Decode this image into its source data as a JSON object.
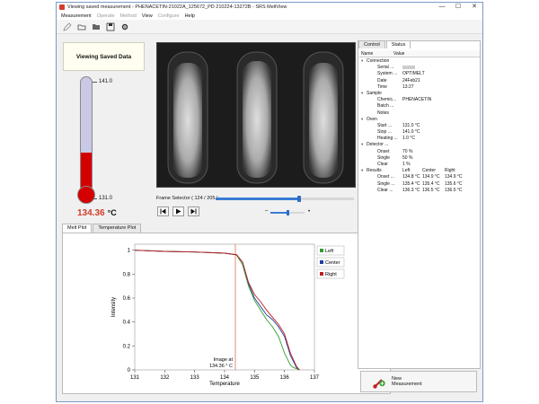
{
  "window": {
    "title": "Viewing saved measurement - PHENACETIN-21022A_125672_PD 210224-13272B - SRS MeltView",
    "controls": [
      "—",
      "☐",
      "✕"
    ]
  },
  "menu": [
    {
      "label": "Measurement",
      "enabled": true
    },
    {
      "label": "Operate",
      "enabled": false
    },
    {
      "label": "Method",
      "enabled": false
    },
    {
      "label": "View",
      "enabled": true
    },
    {
      "label": "Configure",
      "enabled": false
    },
    {
      "label": "Help",
      "enabled": true
    }
  ],
  "toolbar": {
    "icons": [
      "pencil-icon",
      "open-folder-icon",
      "folder-icon",
      "save-icon",
      "settings-icon"
    ]
  },
  "left_panel": {
    "viewing_label": "Viewing Saved Data",
    "thermo_top_label": "141.0",
    "thermo_bottom_label": "131.0",
    "thermo_fill_fraction": 0.34,
    "temperature_value": "134.36",
    "temperature_unit": "°C"
  },
  "frame_selector": {
    "label": "Frame Selector ( 124 / 205 )",
    "current": 124,
    "total": 205,
    "volume_fraction": 0.5
  },
  "plot": {
    "tabs": [
      "Melt Plot",
      "Temperature Plot"
    ],
    "active_tab": 0,
    "annotation_line1": "Image at",
    "annotation_line2": "134.36 ° C",
    "legend": [
      {
        "name": "Left",
        "color": "#2e9e2e"
      },
      {
        "name": "Center",
        "color": "#2040a0"
      },
      {
        "name": "Right",
        "color": "#c02020"
      }
    ]
  },
  "chart_data": {
    "type": "line",
    "title": "",
    "xlabel": "Temperature",
    "ylabel": "Intensity",
    "xlim": [
      131,
      137
    ],
    "ylim": [
      0,
      1.05
    ],
    "xticks": [
      "131",
      "132",
      "133",
      "134",
      "135",
      "136",
      "137"
    ],
    "yticks": [
      "0",
      "0.2",
      "0.4",
      "0.6",
      "0.8",
      "1"
    ],
    "marker_x": 134.36,
    "series": [
      {
        "name": "Left",
        "color": "#2e9e2e",
        "x": [
          131,
          132,
          133,
          134,
          134.4,
          134.6,
          134.8,
          135.0,
          135.2,
          135.4,
          135.6,
          135.8,
          136.0,
          136.2,
          136.3,
          136.5
        ],
        "y": [
          1.0,
          0.99,
          0.985,
          0.975,
          0.96,
          0.88,
          0.7,
          0.58,
          0.5,
          0.42,
          0.36,
          0.28,
          0.14,
          0.04,
          0.02,
          0.0
        ]
      },
      {
        "name": "Center",
        "color": "#2040a0",
        "x": [
          131,
          132,
          133,
          134,
          134.4,
          134.6,
          134.8,
          135.0,
          135.2,
          135.4,
          135.6,
          135.8,
          136.0,
          136.2,
          136.4,
          136.5
        ],
        "y": [
          1.0,
          0.99,
          0.985,
          0.975,
          0.962,
          0.9,
          0.72,
          0.6,
          0.53,
          0.46,
          0.42,
          0.36,
          0.28,
          0.12,
          0.02,
          0.0
        ]
      },
      {
        "name": "Right",
        "color": "#c02020",
        "x": [
          131,
          132,
          133,
          134,
          134.4,
          134.6,
          134.8,
          135.0,
          135.2,
          135.4,
          135.6,
          135.8,
          136.0,
          136.2,
          136.4,
          136.5
        ],
        "y": [
          1.0,
          0.99,
          0.985,
          0.975,
          0.962,
          0.9,
          0.73,
          0.63,
          0.57,
          0.5,
          0.44,
          0.38,
          0.3,
          0.14,
          0.03,
          0.0
        ]
      }
    ]
  },
  "status_panel": {
    "tabs": [
      "Control",
      "Status"
    ],
    "active_tab": 1,
    "header_name": "Name",
    "header_value": "Value",
    "sections": [
      {
        "title": "Connection",
        "rows": [
          {
            "name": "Serial ...",
            "value": "",
            "redacted": true
          },
          {
            "name": "System ...",
            "value": "OPTIMELT"
          },
          {
            "name": "Date",
            "value": "24Feb21"
          },
          {
            "name": "Time",
            "value": "13:27"
          }
        ]
      },
      {
        "title": "Sample",
        "rows": [
          {
            "name": "Chemic...",
            "value": "PHENACETIN"
          },
          {
            "name": "Batch ...",
            "value": ""
          },
          {
            "name": "Notes",
            "value": ""
          }
        ]
      },
      {
        "title": "Oven",
        "rows": [
          {
            "name": "Start ...",
            "value": "131.0 °C"
          },
          {
            "name": "Stop ...",
            "value": "141.0 °C"
          },
          {
            "name": "Heating ...",
            "value": "1.0 °C"
          }
        ]
      },
      {
        "title": "Detector ...",
        "rows": [
          {
            "name": "Onset",
            "value": "70 %"
          },
          {
            "name": "Single",
            "value": "50 %"
          },
          {
            "name": "Clear",
            "value": "1 %"
          }
        ]
      }
    ],
    "results": {
      "title": "Results",
      "columns": [
        "Left",
        "Center",
        "Right"
      ],
      "rows": [
        {
          "name": "Onset ...",
          "values": [
            "134.8 °C",
            "134.9 °C",
            "134.9 °C"
          ]
        },
        {
          "name": "Single ...",
          "values": [
            "135.4 °C",
            "135.4 °C",
            "135.6 °C"
          ]
        },
        {
          "name": "Clear ...",
          "values": [
            "136.3 °C",
            "136.5 °C",
            "136.5 °C"
          ]
        }
      ]
    }
  },
  "new_measurement": {
    "line1": "New",
    "line2": "Measurement"
  }
}
